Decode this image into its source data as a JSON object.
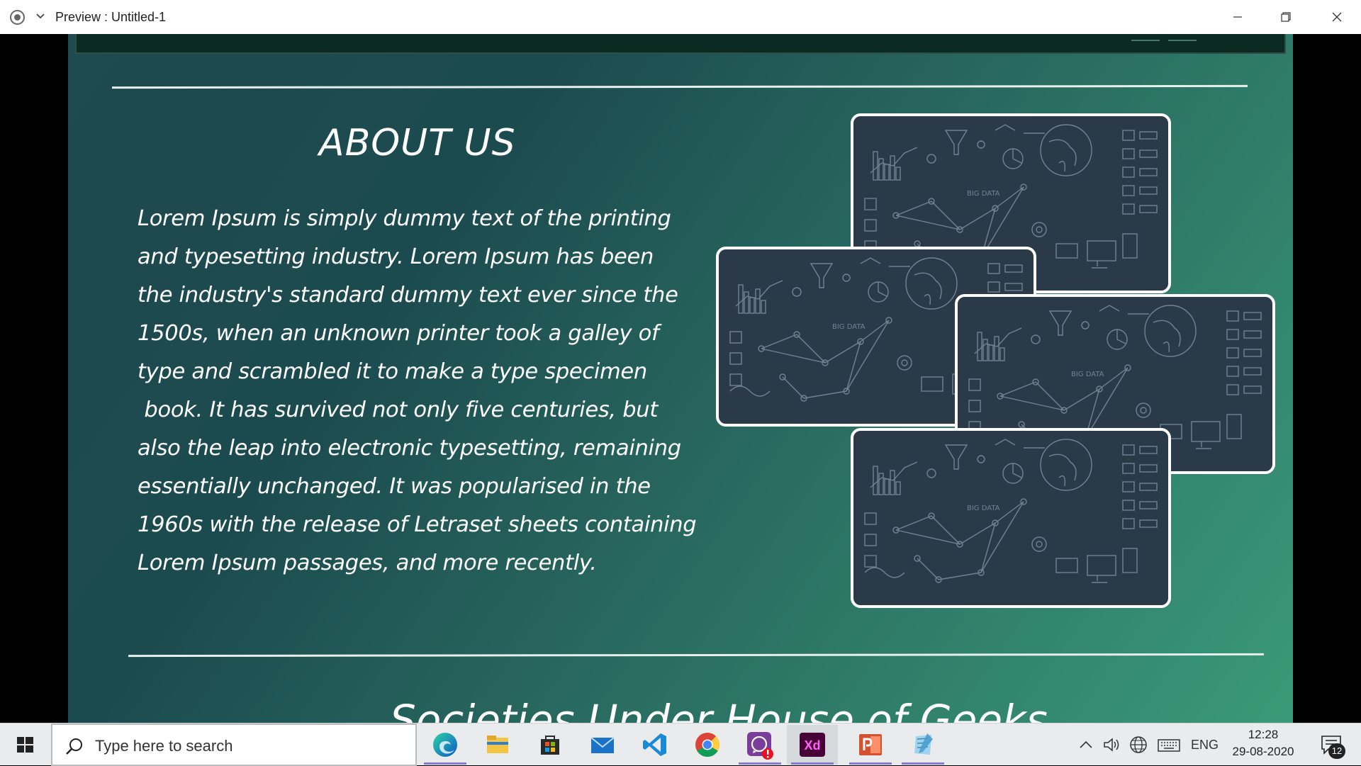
{
  "window": {
    "title": "Preview : Untitled-1"
  },
  "about": {
    "heading": "ABOUT US",
    "lines": [
      "Lorem Ipsum is simply dummy text of the printing",
      "and typesetting industry. Lorem Ipsum has been",
      "the industry's standard dummy text ever since the",
      "1500s, when an unknown printer took a galley of",
      "type and scrambled it to make a type specimen",
      " book. It has survived not only five centuries, but",
      "also the leap into electronic typesetting, remaining",
      "essentially unchanged. It was popularised in the",
      "1960s with the release of Letraset sheets containing",
      "Lorem Ipsum passages, and more recently."
    ]
  },
  "societies": {
    "heading": "Societies Under House of Geeks"
  },
  "card_labels": {
    "big_data": "BIG DATA"
  },
  "taskbar": {
    "search_placeholder": "Type here to search",
    "apps": [
      "edge-icon",
      "file-explorer-icon",
      "store-icon",
      "mail-icon",
      "vscode-icon",
      "chrome-icon",
      "whatsapp-icon",
      "adobe-xd-icon",
      "powerpoint-icon",
      "notepad-icon"
    ],
    "xd_label": "Xd",
    "language": "ENG",
    "time": "12:28",
    "date": "29-08-2020",
    "notification_count": "12"
  },
  "colors": {
    "artboard_start": "#1f4a4f",
    "artboard_end": "#3a9a78",
    "card_bg": "#2b3a49",
    "card_line": "#6f8396"
  }
}
